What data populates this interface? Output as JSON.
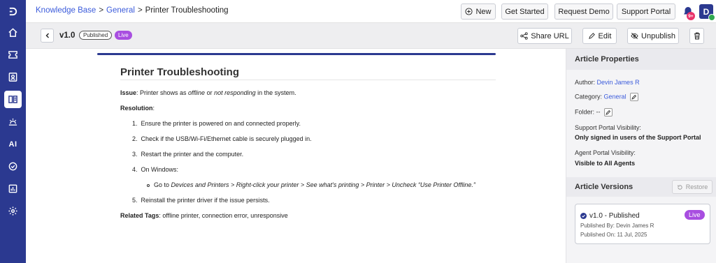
{
  "breadcrumb": {
    "items": [
      "Knowledge Base",
      "General"
    ],
    "separator": ">",
    "current": "Printer Troubleshooting"
  },
  "topbar": {
    "new_label": "New",
    "get_started_label": "Get Started",
    "request_demo_label": "Request Demo",
    "support_portal_label": "Support Portal",
    "notification_count": "9+",
    "avatar_initial": "D"
  },
  "rail": {
    "items": [
      "logo",
      "home",
      "tickets",
      "contacts",
      "knowledge-base",
      "automation",
      "AI",
      "tasks",
      "reports",
      "settings"
    ],
    "ai_label": "AI",
    "active": "knowledge-base"
  },
  "subbar": {
    "version": "v1.0",
    "published_pill": "Published",
    "live_pill": "Live",
    "share_label": "Share URL",
    "edit_label": "Edit",
    "unpublish_label": "Unpublish"
  },
  "article": {
    "title": "Printer Troubleshooting",
    "issue_label": "Issue",
    "issue_text_1": ": Printer shows as ",
    "issue_em_1": "offline",
    "issue_text_2": " or ",
    "issue_em_2": "not responding",
    "issue_text_3": " in the system.",
    "resolution_label": "Resolution",
    "steps": [
      "Ensure the printer is powered on and connected properly.",
      "Check if the USB/Wi-Fi/Ethernet cable is securely plugged in.",
      "Restart the printer and the computer.",
      "On Windows:",
      "Reinstall the printer driver if the issue persists."
    ],
    "step_numbers": [
      "1.",
      "2.",
      "3.",
      "4.",
      "5."
    ],
    "substep_prefix": "Go to ",
    "substep_em": "Devices and Printers > Right-click your printer > See what's printing > Printer > Uncheck “Use Printer Offline.”",
    "related_label": "Related Tags",
    "related_text": ": offline printer, connection error, unresponsive"
  },
  "properties": {
    "heading": "Article Properties",
    "author_label": "Author:",
    "author_value": "Devin James R",
    "category_label": "Category:",
    "category_value": "General",
    "folder_label": "Folder:",
    "folder_value": "--",
    "support_vis_label": "Support Portal Visibility:",
    "support_vis_value": "Only signed in users of the Support Portal",
    "agent_vis_label": "Agent Portal Visibility:",
    "agent_vis_value": "Visible to All Agents"
  },
  "versions": {
    "heading": "Article Versions",
    "restore_label": "Restore",
    "card": {
      "title": "v1.0 -  Published",
      "live": "Live",
      "published_by": "Published By: Devin James R",
      "published_on": "Published On: 11 Jul, 2025"
    }
  },
  "colors": {
    "brand": "#2b3990",
    "link": "#3b5bdb",
    "live": "#a84ee0",
    "badge": "#e8336b",
    "online": "#2fa84f"
  }
}
